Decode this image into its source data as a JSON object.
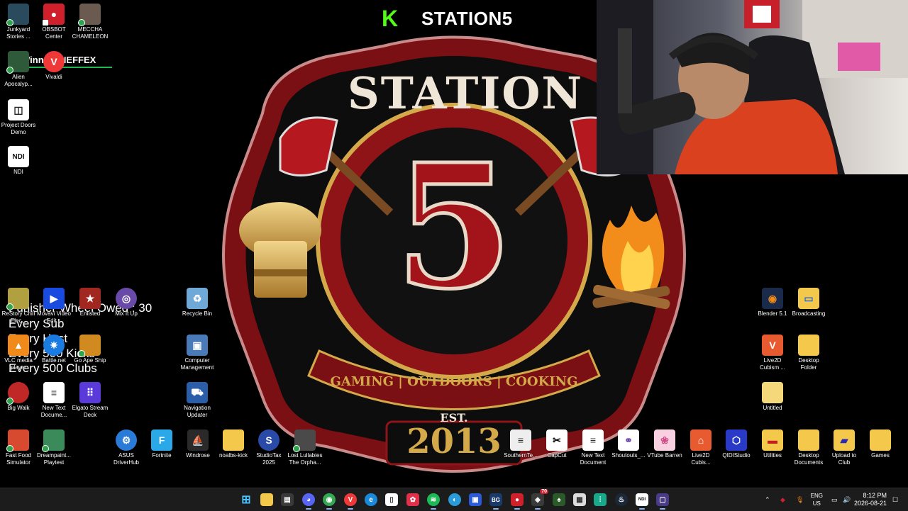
{
  "colors": {
    "kick_green": "#53fc18",
    "badge_red": "#8e1418",
    "gold": "#d4a94a",
    "taskbar_bg": "#1c1c1c"
  },
  "stream": {
    "platform_logo": "K",
    "channel_name": "STATION5"
  },
  "logo": {
    "top_text": "STATION",
    "number": "5",
    "est_label": "EST.",
    "tagline": "GAMING | OUTDOORS | COOKING",
    "year": "2013"
  },
  "now_playing": "Winn... - NEFFEX",
  "goals": {
    "wheel_owed": "Punisher Wheel Owed : 30",
    "lines": [
      "Every Sub",
      "Every Host",
      "Every 500 Kicks",
      "Every 500 Clubs"
    ]
  },
  "desktop_icons": [
    {
      "label": "Junkyard Stories ...",
      "icon": "game-icon"
    },
    {
      "label": "OBSBOT Center",
      "icon": "obsbot-icon"
    },
    {
      "label": "MECCHA CHAMELEON",
      "icon": "game-icon"
    },
    {
      "label": "Alien Apocalyp...",
      "icon": "game-icon"
    },
    {
      "label": "Vivaldi",
      "icon": "vivaldi-icon"
    },
    {
      "label": "Project Doors Demo",
      "icon": "doors-icon"
    },
    {
      "label": "NDI",
      "icon": "ndi-icon"
    },
    {
      "label": "ReStory Chill Elec...",
      "icon": "game-icon"
    },
    {
      "label": "Movavi Video Edit...",
      "icon": "movavi-icon"
    },
    {
      "label": "Enlisted",
      "icon": "enlisted-icon"
    },
    {
      "label": "Mix It Up",
      "icon": "mixitup-icon"
    },
    {
      "label": "Recycle Bin",
      "icon": "recycle-bin-icon"
    },
    {
      "label": "VLC media player",
      "icon": "vlc-icon"
    },
    {
      "label": "Battle.net",
      "icon": "battlenet-icon"
    },
    {
      "label": "Go Ape Ship",
      "icon": "game-icon"
    },
    {
      "label": "Computer Management",
      "icon": "computer-management-icon"
    },
    {
      "label": "Big Walk",
      "icon": "game-icon"
    },
    {
      "label": "New Text Docume...",
      "icon": "text-document-icon"
    },
    {
      "label": "Elgato Stream Deck",
      "icon": "streamdeck-icon"
    },
    {
      "label": "Navigation Updater",
      "icon": "navigation-icon"
    },
    {
      "label": "Fast Food Simulator",
      "icon": "game-icon"
    },
    {
      "label": "Dreampaint... Playtest",
      "icon": "game-icon"
    },
    {
      "label": "ASUS DriverHub",
      "icon": "asus-icon"
    },
    {
      "label": "Fortnite",
      "icon": "fortnite-icon"
    },
    {
      "label": "Windrose",
      "icon": "game-icon"
    },
    {
      "label": "noalbs-kick",
      "icon": "folder-icon"
    },
    {
      "label": "StudioTax 2025",
      "icon": "studiotax-icon"
    },
    {
      "label": "Lost Lullabies The Orpha...",
      "icon": "game-icon"
    },
    {
      "label": "SouthernTe...",
      "icon": "text-document-icon"
    },
    {
      "label": "CapCut",
      "icon": "capcut-icon"
    },
    {
      "label": "New Text Document",
      "icon": "text-document-icon"
    },
    {
      "label": "Shoutouts_...",
      "icon": "shoutouts-icon"
    },
    {
      "label": "VTube Barren",
      "icon": "vtube-icon"
    },
    {
      "label": "Live2D Cubis...",
      "icon": "live2d-icon"
    },
    {
      "label": "QIDIStudio",
      "icon": "qidi-icon"
    },
    {
      "label": "Utilities",
      "icon": "folder-icon"
    },
    {
      "label": "Desktop Documents",
      "icon": "folder-icon"
    },
    {
      "label": "Upload to Club",
      "icon": "folder-icon"
    },
    {
      "label": "Games",
      "icon": "folder-icon"
    },
    {
      "label": "Blender 5.1",
      "icon": "blender-icon"
    },
    {
      "label": "Broadcasting",
      "icon": "folder-icon"
    },
    {
      "label": "Live2D Cubism ...",
      "icon": "live2d-icon"
    },
    {
      "label": "Desktop Folder",
      "icon": "folder-icon"
    },
    {
      "label": "Untitled",
      "icon": "folder-icon"
    }
  ],
  "taskbar": {
    "apps": [
      "start-icon",
      "file-explorer-icon",
      "store-icon",
      "discord-icon",
      "chrome-icon",
      "vivaldi-icon",
      "edge-icon",
      "file-icon",
      "spotify-icon",
      "app-icon",
      "app-icon",
      "app-icon",
      "bg-icon",
      "obsbot-icon",
      "app-icon",
      "app-icon",
      "calculator-icon",
      "app-icon",
      "steam-icon",
      "ndi-icon",
      "app-icon"
    ],
    "bg_label": "BG",
    "ndi_label": "NDI",
    "badge_count": "70",
    "lang_top": "ENG",
    "lang_bottom": "US",
    "time": "8:12 PM",
    "date": "2026-08-21"
  }
}
